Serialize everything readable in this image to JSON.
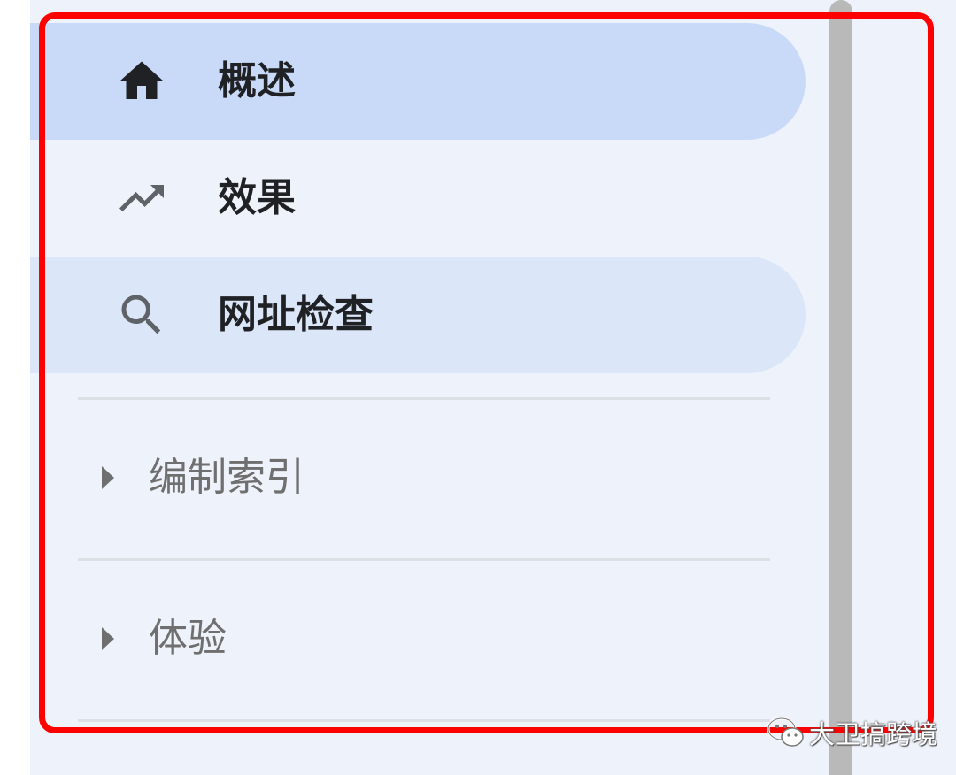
{
  "nav": {
    "items": [
      {
        "label": "概述",
        "icon": "home-icon",
        "state": "selected"
      },
      {
        "label": "效果",
        "icon": "trending-up-icon",
        "state": "default"
      },
      {
        "label": "网址检查",
        "icon": "search-icon",
        "state": "hovered"
      }
    ],
    "sections": [
      {
        "label": "编制索引",
        "icon": "caret-right-icon",
        "expanded": false
      },
      {
        "label": "体验",
        "icon": "caret-right-icon",
        "expanded": false
      }
    ]
  },
  "watermark": {
    "text": "大卫搞跨境",
    "icon": "wechat-icon"
  },
  "colors": {
    "panel_background": "#eef2fa",
    "selected_background": "#c9daf9",
    "hover_background": "#dbe6f9",
    "highlight_border": "#ff0000",
    "scrollbar": "#b9b9b9"
  }
}
